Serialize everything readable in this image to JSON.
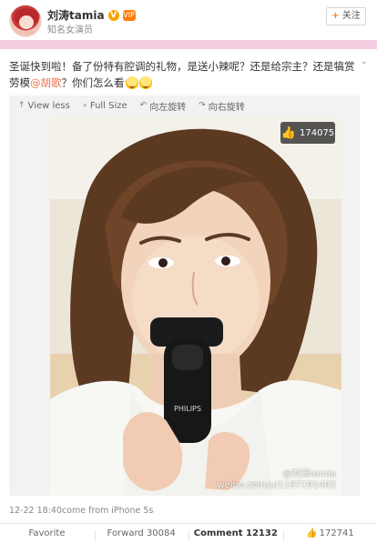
{
  "header": {
    "user_name": "刘涛tamia",
    "verified_badge": "V",
    "vip_badge": "VIP",
    "user_desc": "知名女演员",
    "follow_label": "关注",
    "follow_icon": "+"
  },
  "post": {
    "text_part1": "圣诞快到啦！备了份特有腔调的礼物，是送小辣呢？还是给宗主？还是犒赏劳模",
    "mention": "@胡歌",
    "text_part2": "？你们怎么看",
    "emoji_count": 2,
    "chevron_icon": "chevron-down-icon"
  },
  "toolbar": {
    "view_less": "View less",
    "full_size": "Full Size",
    "rotate_left": "向左旋转",
    "rotate_right": "向右旋转"
  },
  "photo": {
    "like_count": "174075",
    "watermark_line1": "@刘涛tamia",
    "watermark_line2": "weibo.com/u/1197191492"
  },
  "meta": {
    "timestamp": "12-22 18:40",
    "source": "come from iPhone 5s"
  },
  "actions": {
    "favorite": "Favorite",
    "forward": "Forward 30084",
    "comment": "Comment 12132",
    "like": "172741"
  },
  "colors": {
    "accent_orange": "#ff8200",
    "mention": "#eb7350",
    "pink_strip": "#f6cde0"
  }
}
